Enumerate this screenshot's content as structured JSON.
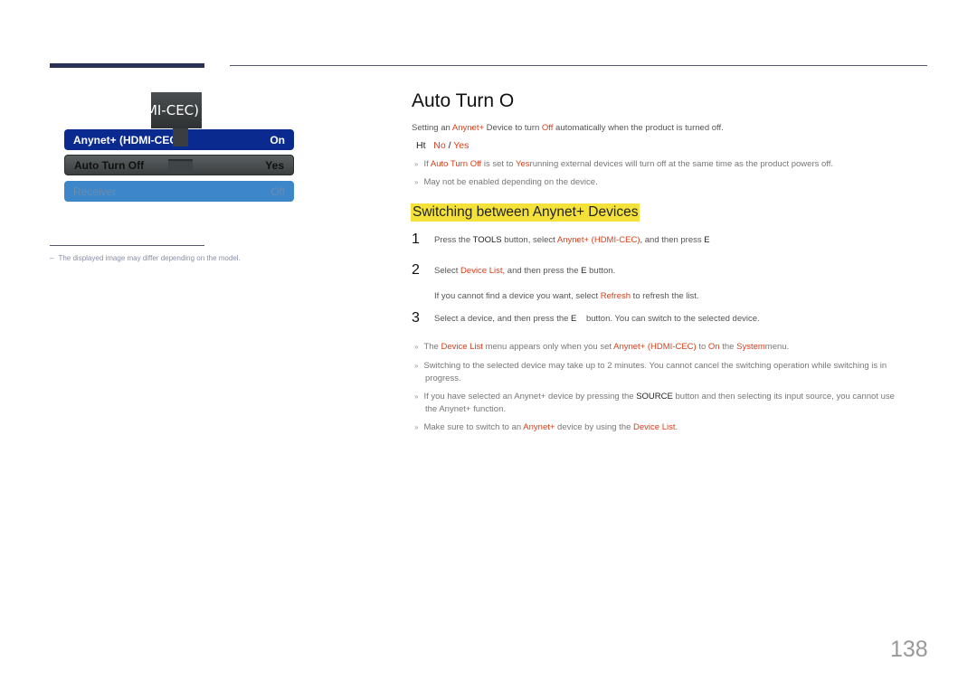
{
  "header": {
    "decor": "rules"
  },
  "osd": {
    "tab_label": "MI-CEC)",
    "rows": [
      {
        "label": "Anynet+ (HDMI-CEC)",
        "value": "On",
        "state": "selected"
      },
      {
        "label": "Auto Turn Off",
        "value": "Yes",
        "state": "focused"
      },
      {
        "label": "Receiver",
        "value": "Off",
        "state": "disabled"
      }
    ]
  },
  "note": {
    "dash": "–",
    "text": "The displayed image may differ depending on the model."
  },
  "content": {
    "title": "Auto Turn O",
    "intro": {
      "p1": "Setting an ",
      "r1": "Anynet+",
      "p2": " Device to turn ",
      "r2": "Off",
      "p3": " automatically when the product is turned off."
    },
    "options": {
      "prefix": "Ht",
      "opt1": "No",
      "sep": " / ",
      "opt2": "Yes"
    },
    "bullets1": [
      {
        "p1": "If ",
        "r1": "Auto Turn Off",
        "p2": " is set to ",
        "r2": "Yes",
        "p3": "running external devices will turn off at the same time as the product powers off."
      },
      {
        "text": "May not be enabled depending on the device."
      }
    ],
    "section_title": "Switching between Anynet+ Devices",
    "steps": [
      {
        "num": "1",
        "p1": "Press the ",
        "b1": "TOOLS",
        "p2": " button, select ",
        "r1": "Anynet+ (HDMI-CEC)",
        "p3": ", and then press ",
        "b2": "E"
      },
      {
        "num": "2",
        "p1": "Select ",
        "r1": "Device List",
        "p2": ", and then press the ",
        "b1": "E",
        "p3": " button."
      },
      {
        "sub_p1": "If you cannot find a device you want, select ",
        "sub_r1": "Refresh",
        "sub_p2": " to refresh the list."
      },
      {
        "num": "3",
        "p1": "Select a device, and then press the ",
        "b1": "E",
        "p2": "    button. You can switch to the selected device."
      }
    ],
    "bullets2": [
      {
        "p1": "The ",
        "r1": "Device List",
        "p2": " menu appears only when you set ",
        "r2": "Anynet+ (HDMI-CEC)",
        "p3": " to ",
        "r3": "On",
        "p4": " the ",
        "r4": "System",
        "p5": "menu."
      },
      {
        "line1": "Switching to the selected device may take up to 2 minutes. You cannot cancel the switching operation while switching is in",
        "line2": "progress."
      },
      {
        "p1": "If you have selected an Anynet+ device by pressing the ",
        "b1": "SOURCE",
        "p2": " button and then selecting its input source, you cannot use",
        "line2": "the Anynet+ function."
      },
      {
        "p1": "Make sure to switch to an ",
        "r1": "Anynet+",
        "p2": " device by using the ",
        "r2": "Device List",
        "p3": "."
      }
    ],
    "bullet_mark": "»"
  },
  "page_number": "138"
}
